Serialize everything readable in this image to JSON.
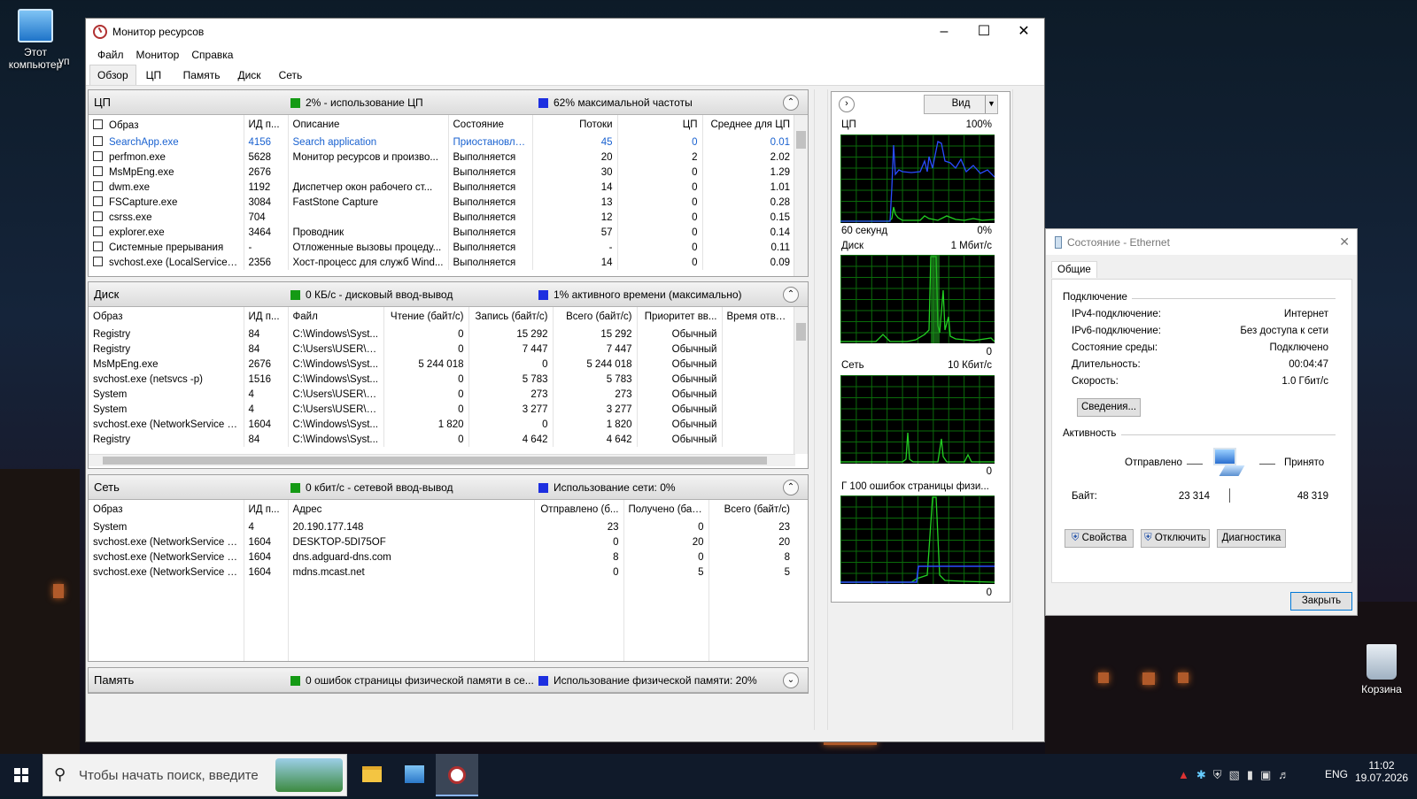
{
  "desktop": {
    "icon_computer": "Этот\nкомпьютер",
    "icon_computer_l1": "Этот",
    "icon_computer_l2": "компьютер",
    "icon_partial": "уп",
    "icon_recycle": "Корзина"
  },
  "window": {
    "title": "Монитор ресурсов",
    "menu": [
      "Файл",
      "Монитор",
      "Справка"
    ],
    "tabs": [
      "Обзор",
      "ЦП",
      "Память",
      "Диск",
      "Сеть"
    ],
    "active_tab": "Обзор"
  },
  "cpu": {
    "name": "ЦП",
    "legend_green": "2% - использование ЦП",
    "legend_blue": "62% максимальной частоты",
    "headers": [
      "Образ",
      "ИД п...",
      "Описание",
      "Состояние",
      "Потоки",
      "ЦП",
      "Среднее для ЦП"
    ],
    "rows": [
      [
        "SearchApp.exe",
        "4156",
        "Search application",
        "Приостановле...",
        "45",
        "0",
        "0.01"
      ],
      [
        "perfmon.exe",
        "5628",
        "Монитор ресурсов и произво...",
        "Выполняется",
        "20",
        "2",
        "2.02"
      ],
      [
        "MsMpEng.exe",
        "2676",
        "",
        "Выполняется",
        "30",
        "0",
        "1.29"
      ],
      [
        "dwm.exe",
        "1192",
        "Диспетчер окон рабочего ст...",
        "Выполняется",
        "14",
        "0",
        "1.01"
      ],
      [
        "FSCapture.exe",
        "3084",
        "FastStone Capture",
        "Выполняется",
        "13",
        "0",
        "0.28"
      ],
      [
        "csrss.exe",
        "704",
        "",
        "Выполняется",
        "12",
        "0",
        "0.15"
      ],
      [
        "explorer.exe",
        "3464",
        "Проводник",
        "Выполняется",
        "57",
        "0",
        "0.14"
      ],
      [
        "Системные прерывания",
        "-",
        "Отложенные вызовы процеду...",
        "Выполняется",
        "-",
        "0",
        "0.11"
      ],
      [
        "svchost.exe (LocalServiceNo...",
        "2356",
        "Хост-процесс для служб Wind...",
        "Выполняется",
        "14",
        "0",
        "0.09"
      ]
    ]
  },
  "disk": {
    "name": "Диск",
    "legend_green": "0 КБ/с - дисковый ввод-вывод",
    "legend_blue": "1% активного времени (максимально)",
    "headers": [
      "Образ",
      "ИД п...",
      "Файл",
      "Чтение (байт/с)",
      "Запись (байт/с)",
      "Всего (байт/с)",
      "Приоритет вв...",
      "Время ответа"
    ],
    "rows": [
      [
        "Registry",
        "84",
        "C:\\Windows\\Syst...",
        "0",
        "15 292",
        "15 292",
        "Обычный",
        ""
      ],
      [
        "Registry",
        "84",
        "C:\\Users\\USER\\nt...",
        "0",
        "7 447",
        "7 447",
        "Обычный",
        ""
      ],
      [
        "MsMpEng.exe",
        "2676",
        "C:\\Windows\\Syst...",
        "5 244 018",
        "0",
        "5 244 018",
        "Обычный",
        ""
      ],
      [
        "svchost.exe (netsvcs -p)",
        "1516",
        "C:\\Windows\\Syst...",
        "0",
        "5 783",
        "5 783",
        "Обычный",
        ""
      ],
      [
        "System",
        "4",
        "C:\\Users\\USER\\Ap...",
        "0",
        "273",
        "273",
        "Обычный",
        ""
      ],
      [
        "System",
        "4",
        "C:\\Users\\USER\\Ap...",
        "0",
        "3 277",
        "3 277",
        "Обычный",
        ""
      ],
      [
        "svchost.exe (NetworkService -p)",
        "1604",
        "C:\\Windows\\Syst...",
        "1 820",
        "0",
        "1 820",
        "Обычный",
        ""
      ],
      [
        "Registry",
        "84",
        "C:\\Windows\\Syst...",
        "0",
        "4 642",
        "4 642",
        "Обычный",
        ""
      ]
    ]
  },
  "net": {
    "name": "Сеть",
    "legend_green": "0 кбит/с - сетевой ввод-вывод",
    "legend_blue": "Использование сети: 0%",
    "headers": [
      "Образ",
      "ИД п...",
      "Адрес",
      "Отправлено (б...",
      "Получено (бай...",
      "Всего (байт/с)"
    ],
    "rows": [
      [
        "System",
        "4",
        "20.190.177.148",
        "23",
        "0",
        "23"
      ],
      [
        "svchost.exe (NetworkService -p)",
        "1604",
        "DESKTOP-5DI75OF",
        "0",
        "20",
        "20"
      ],
      [
        "svchost.exe (NetworkService -p)",
        "1604",
        "dns.adguard-dns.com",
        "8",
        "0",
        "8"
      ],
      [
        "svchost.exe (NetworkService -p)",
        "1604",
        "mdns.mcast.net",
        "0",
        "5",
        "5"
      ]
    ]
  },
  "memory": {
    "name": "Память",
    "legend_green": "0 ошибок страницы физической памяти в се...",
    "legend_blue": "Использование физической памяти: 20%"
  },
  "graphs": {
    "view_label": "Вид",
    "cpu_label": "ЦП",
    "cpu_max": "100%",
    "cpu_time": "60 секунд",
    "cpu_min": "0%",
    "disk_label": "Диск",
    "disk_max": "1 Мбит/с",
    "disk_min": "0",
    "net_label": "Сеть",
    "net_max": "10 Кбит/с",
    "net_min": "0",
    "mem_label": "Г 100 ошибок страницы физи...",
    "mem_min": "0"
  },
  "ethernet": {
    "title": "Состояние - Ethernet",
    "tab": "Общие",
    "conn_group": "Подключение",
    "rows": [
      [
        "IPv4-подключение:",
        "Интернет"
      ],
      [
        "IPv6-подключение:",
        "Без доступа к сети"
      ],
      [
        "Состояние среды:",
        "Подключено"
      ],
      [
        "Длительность:",
        "00:04:47"
      ],
      [
        "Скорость:",
        "1.0 Гбит/с"
      ]
    ],
    "details_btn": "Сведения...",
    "activity_group": "Активность",
    "sent_label": "Отправлено",
    "recv_label": "Принято",
    "bytes_label": "Байт:",
    "bytes_sent": "23 314",
    "bytes_recv": "48 319",
    "props_btn": "Свойства",
    "disable_btn": "Отключить",
    "diag_btn": "Диагностика",
    "close_btn": "Закрыть"
  },
  "taskbar": {
    "search_placeholder": "Чтобы начать поиск, введите",
    "lang": "ENG",
    "time": "11:02",
    "date": "19.07.2026"
  }
}
